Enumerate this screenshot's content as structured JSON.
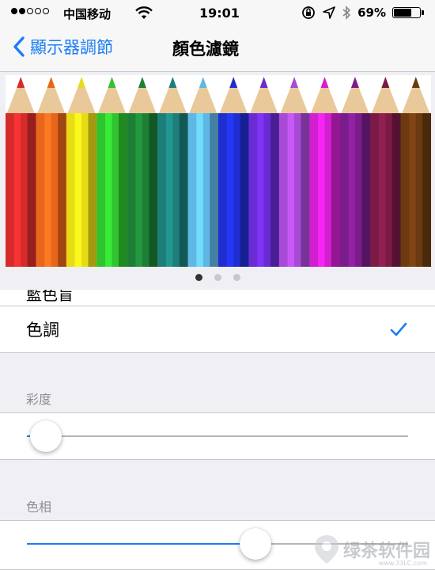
{
  "status": {
    "carrier": "中国移动",
    "time": "19:01",
    "battery_text": "69%",
    "battery_level": 0.69
  },
  "nav": {
    "back_label": "顯示器調節",
    "title": "顏色濾鏡"
  },
  "preview": {
    "pencil_colors": [
      "#d62b2b",
      "#e8651c",
      "#e8dc17",
      "#2fc42f",
      "#1d7f35",
      "#1d7e7a",
      "#5fb7e6",
      "#1f2ed0",
      "#6a2bd3",
      "#a74ad6",
      "#d21fd0",
      "#7a1c8a",
      "#7a1a45",
      "#6b3a10"
    ],
    "page_count": 3,
    "active_page": 0
  },
  "list": {
    "partial_label": "藍色盲",
    "hue_label": "色調",
    "hue_selected": true,
    "accent": "#1b7cf5"
  },
  "saturation": {
    "header": "彩度",
    "value": 0.05
  },
  "hue_adjust": {
    "header": "色相",
    "value": 0.6
  },
  "watermark": {
    "text": "绿茶软件园",
    "url": "www.33LC.com"
  }
}
